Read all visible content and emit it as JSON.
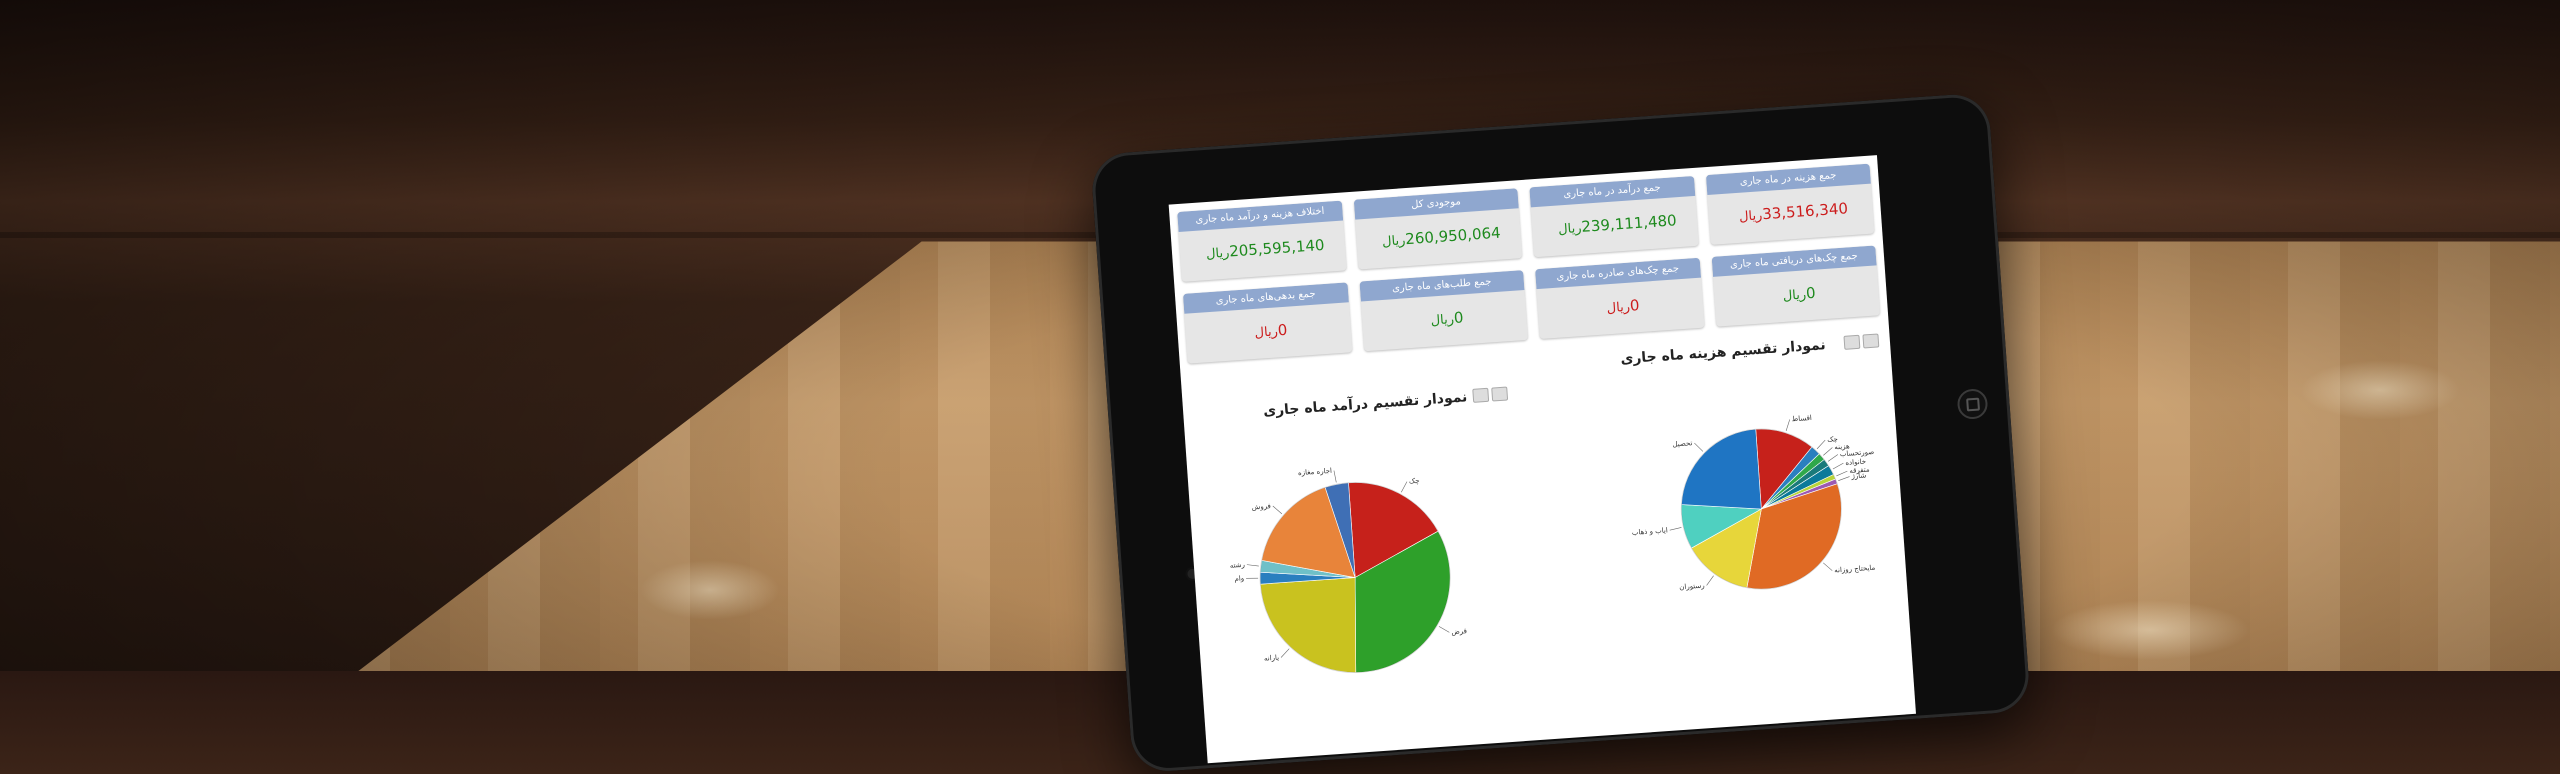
{
  "dashboard": {
    "stats": [
      {
        "title": "جمع هزینه در ماه جاری",
        "value": "33,516,340",
        "unit": "ریال",
        "color": "#cc1d1d"
      },
      {
        "title": "جمع درآمد در ماه جاری",
        "value": "239,111,480",
        "unit": "ریال",
        "color": "#1e8a1e"
      },
      {
        "title": "موجودی کل",
        "value": "260,950,064",
        "unit": "ریال",
        "color": "#1e8a1e"
      },
      {
        "title": "اختلاف هزینه و درآمد ماه جاری",
        "value": "205,595,140",
        "unit": "ریال",
        "color": "#1e8a1e"
      },
      {
        "title": "جمع چک‌های دریافتی ماه جاری",
        "value": "0",
        "unit": "ریال",
        "color": "#1e8a1e"
      },
      {
        "title": "جمع چک‌های صادره ماه جاری",
        "value": "0",
        "unit": "ریال",
        "color": "#cc1d1d"
      },
      {
        "title": "جمع طلب‌های ماه جاری",
        "value": "0",
        "unit": "ریال",
        "color": "#1e8a1e"
      },
      {
        "title": "جمع بدهی‌های ماه جاری",
        "value": "0",
        "unit": "ریال",
        "color": "#cc1d1d"
      }
    ],
    "expense_chart_title": "نمودار تقسیم هزینه ماه جاری",
    "income_chart_title": "نمودار تقسیم درآمد ماه جاری"
  },
  "chart_data": [
    {
      "type": "pie",
      "title": "نمودار تقسیم هزینه ماه جاری",
      "categories": [
        "اقساط",
        "چک",
        "هزینه",
        "صورتحساب",
        "خانواده",
        "متفرقه",
        "شارژ",
        "مایحتاج روزانه",
        "رستوران",
        "ایاب و ذهاب",
        "تحصیل"
      ],
      "values": [
        12,
        2,
        1.5,
        1.5,
        2,
        1,
        1,
        33,
        14,
        9,
        23
      ],
      "colors": [
        "#c6211b",
        "#2a7fbf",
        "#2fa84a",
        "#1a7a7a",
        "#0b7a9a",
        "#b8d43a",
        "#9c5ab2",
        "#e06a24",
        "#e7d63a",
        "#4fd0c0",
        "#1f75c3"
      ],
      "labels_shown": [
        "اقساط",
        "چک",
        "هزینه",
        "صورتحساب",
        "خانواده",
        "مایحتاج روزانه",
        "رستوران",
        "ایاب و ذهاب",
        "تحصیل"
      ]
    },
    {
      "type": "pie",
      "title": "نمودار تقسیم درآمد ماه جاری",
      "categories": [
        "چک",
        "قرض",
        "یارانه",
        "وام",
        "رشته",
        "فروش",
        "اجاره مغازه"
      ],
      "values": [
        18,
        33,
        24,
        2,
        2,
        17,
        4
      ],
      "colors": [
        "#c6211b",
        "#2ea02a",
        "#c9c21f",
        "#2a7fbf",
        "#6fc0c8",
        "#e8843a",
        "#3f6fb5"
      ],
      "labels_shown": [
        "چک",
        "قرض",
        "یارانه",
        "وام",
        "رشته",
        "فروش",
        "اجاره مغازه"
      ]
    }
  ]
}
